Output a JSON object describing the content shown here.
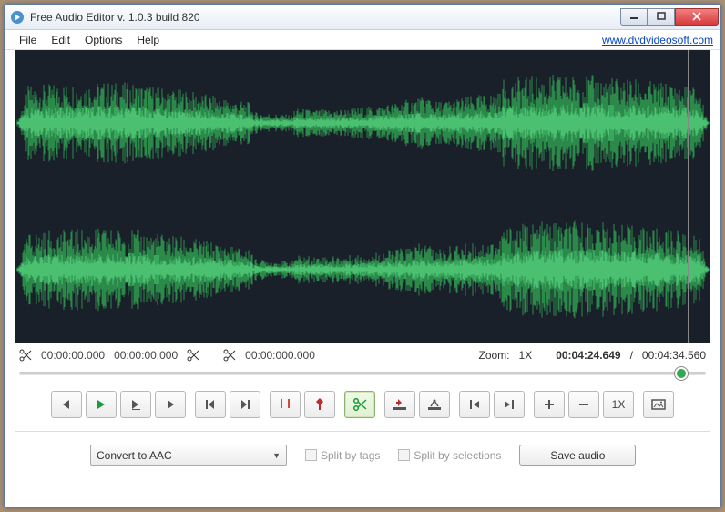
{
  "window": {
    "title": "Free Audio Editor v. 1.0.3 build 820"
  },
  "menu": {
    "file": "File",
    "edit": "Edit",
    "options": "Options",
    "help": "Help",
    "link": "www.dvdvideosoft.com"
  },
  "info": {
    "sel_start": "00:00:00.000",
    "sel_end": "00:00:00.000",
    "cut_time": "00:00:000.000",
    "zoom_label": "Zoom:",
    "zoom_value": "1X",
    "position": "00:04:24.649",
    "separator": "/",
    "duration": "00:04:34.560"
  },
  "toolbar": {
    "zoom_reset": "1X"
  },
  "bottom": {
    "convert_label": "Convert to AAC",
    "split_tags": "Split by tags",
    "split_sel": "Split by selections",
    "save": "Save audio"
  }
}
